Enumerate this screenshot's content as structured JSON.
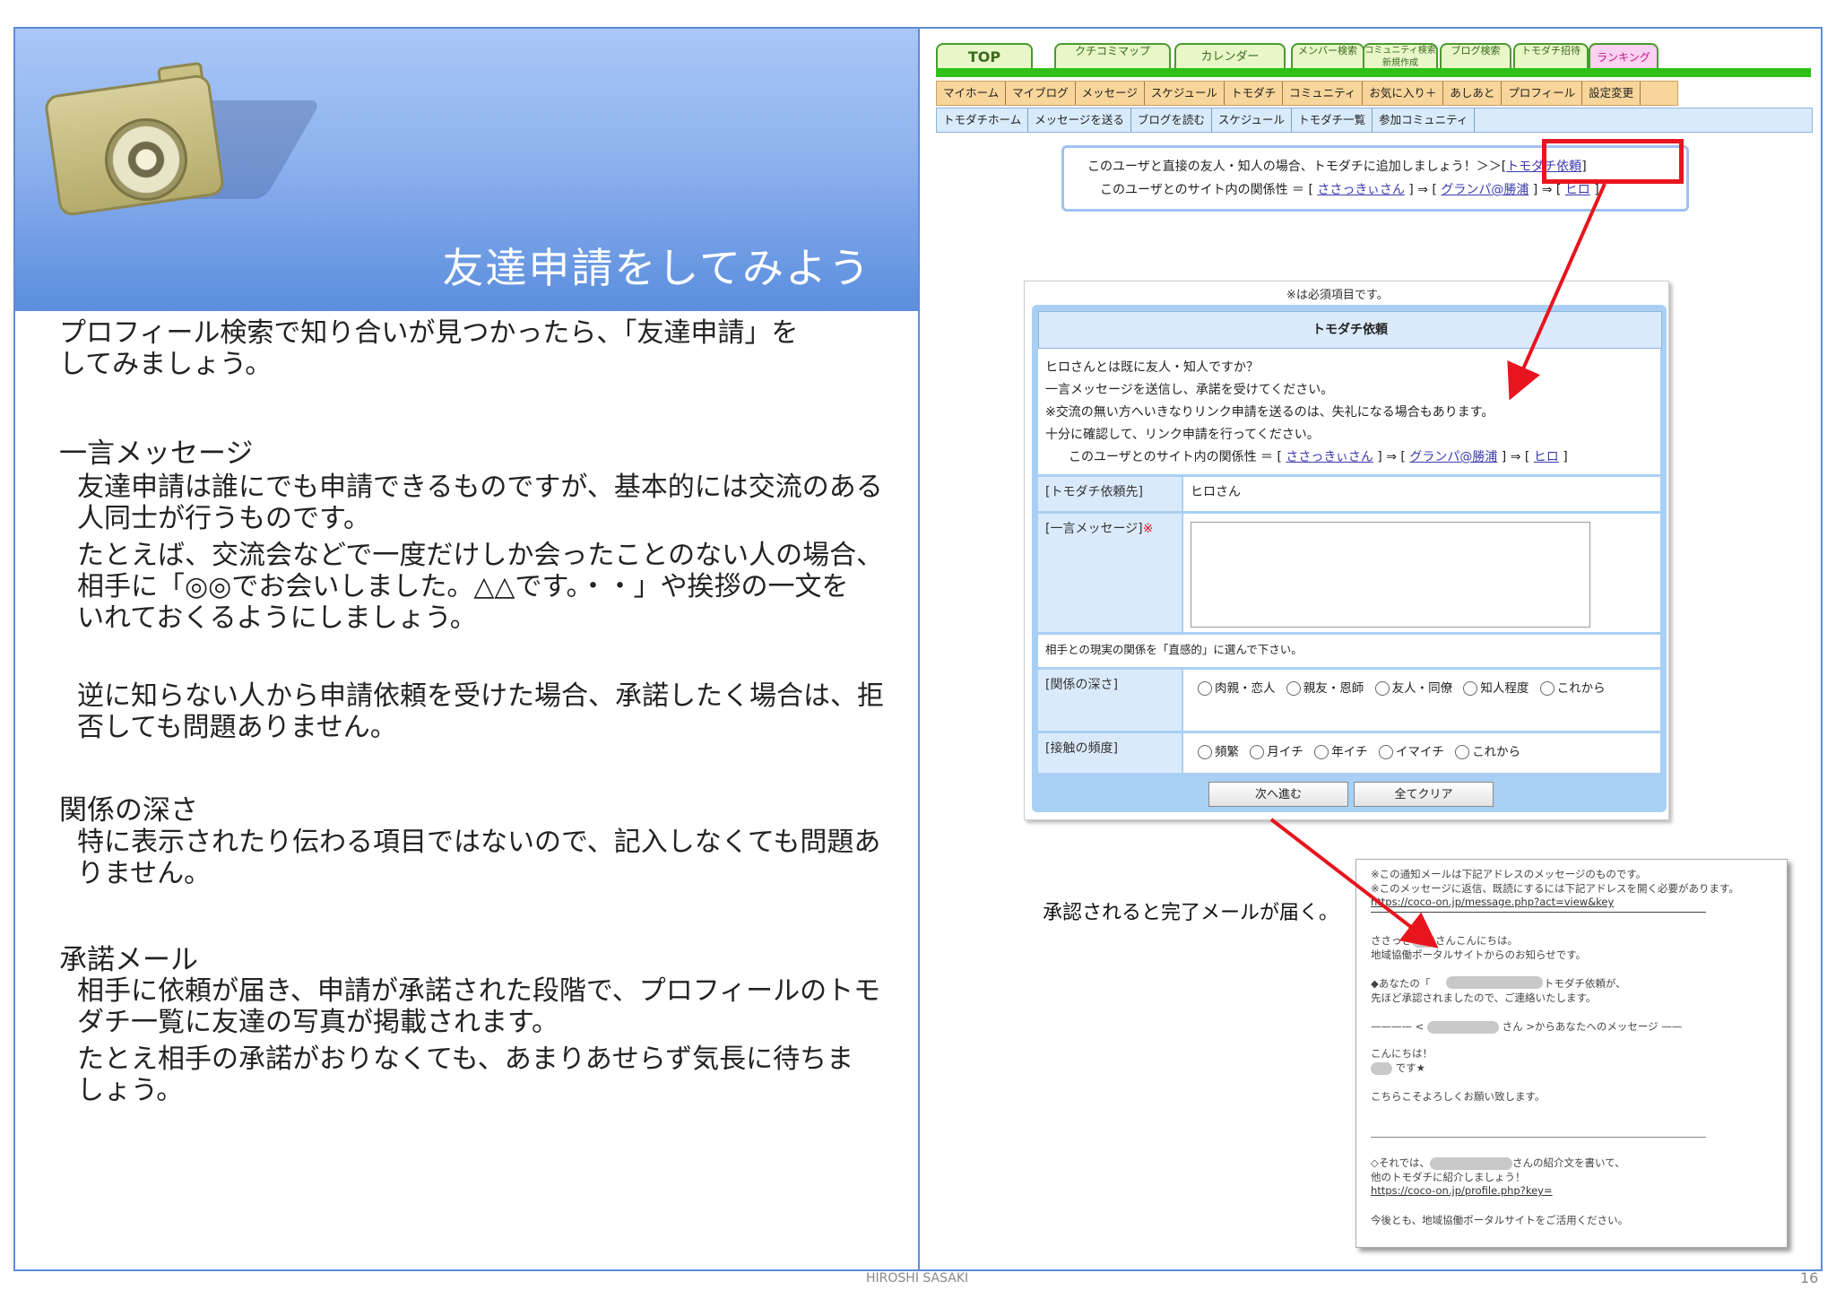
{
  "title": "友達申請をしてみよう",
  "left": {
    "intro": [
      "プロフィール検索で知り合いが見つかったら、「友達申請」を",
      "してみましょう。"
    ],
    "sections": [
      {
        "heading": "一言メッセージ",
        "lines": [
          "友達申請は誰にでも申請できるものですが、基本的には交流のある",
          "人同士が行うものです。",
          "たとえば、交流会などで一度だけしか会ったことのない人の場合、",
          "相手に「◎◎でお会いしました。△△です。・・」や挨拶の一文を",
          "いれておくるようにしましょう。",
          "逆に知らない人から申請依頼を受けた場合、承諾したく場合は、拒",
          "否しても問題ありません。"
        ]
      },
      {
        "heading": "関係の深さ",
        "lines": [
          "特に表示されたり伝わる項目ではないので、記入しなくても問題あ",
          "りません。"
        ]
      },
      {
        "heading": "承諾メール",
        "lines": [
          "相手に依頼が届き、申請が承諾された段階で、プロフィールのトモ",
          "ダチ一覧に友達の写真が掲載されます。",
          "たとえ相手の承諾がおりなくても、あまりあせらず気長に待ちま",
          "しょう。"
        ]
      }
    ]
  },
  "site": {
    "tabs": [
      "TOP",
      "クチコミマップ",
      "カレンダー",
      "メンバー検索",
      "コミュニティ検索 新規作成",
      "ブログ検索",
      "トモダチ招待",
      "ランキング"
    ],
    "menu1": [
      "マイホーム",
      "マイブログ",
      "メッセージ",
      "スケジュール",
      "トモダチ",
      "コミュニティ",
      "お気に入り＋",
      "あしあと",
      "プロフィール",
      "設定変更"
    ],
    "menu2": [
      "トモダチホーム",
      "メッセージを送る",
      "ブログを読む",
      "スケジュール",
      "トモダチ一覧",
      "参加コミュニティ"
    ],
    "notice_line1": "このユーザと直接の友人・知人の場合、トモダチに追加しましょう！＞＞",
    "notice_link": "トモダチ依頼",
    "notice_line2_prefix": "このユーザとのサイト内の関係性 ＝ [",
    "notice_rel": [
      "ささっきぃさん",
      "グランパ@勝浦",
      "ヒロ"
    ]
  },
  "form": {
    "required_note": "※は必須項目です。",
    "header": "トモダチ依頼",
    "intro": [
      "ヒロさんとは既に友人・知人ですか？",
      "一言メッセージを送信し、承諾を受けてください。",
      "※交流の無い方へいきなりリンク申請を送るのは、失礼になる場合もあります。",
      "十分に確認して、リンク申請を行ってください。"
    ],
    "relation_prefix": "このユーザとのサイト内の関係性 ＝ [",
    "relation": [
      "ささっきぃさん",
      "グランパ@勝浦",
      "ヒロ"
    ],
    "to_label": "[トモダチ依頼先]",
    "to_value": "ヒロさん",
    "msg_label": "[一言メッセージ]",
    "note": "相手との現実の関係を「直感的」に選んで下さい。",
    "depth_label": "[関係の深さ]",
    "depth_options": [
      "肉親・恋人",
      "親友・恩師",
      "友人・同僚",
      "知人程度",
      "これから"
    ],
    "freq_label": "[接触の頻度]",
    "freq_options": [
      "頻繁",
      "月イチ",
      "年イチ",
      "イマイチ",
      "これから"
    ],
    "next_btn": "次へ進む",
    "clear_btn": "全てクリア"
  },
  "caption": "承認されると完了メールが届く。",
  "mail": {
    "lines": [
      "※この通知メールは下記アドレスのメッセージのものです。",
      "※このメッセージに返信、既読にするには下記アドレスを開く必要があります。"
    ],
    "url1": "https://coco-on.jp/message.php?act=view&key",
    "greet": "さんこんにちは。",
    "from": "地域協働ポータルサイトからのお知らせです。",
    "notice": "◆あなたの「　　　　　　　　」へのトモダチ依頼が、",
    "notice2": "先ほど承認されましたので、ご連絡いたします。",
    "msgline": "さん >からあなたへのメッセージ ——",
    "hello": "こんにちは！",
    "desu": "です★",
    "regards": "こちらこそよろしくお願い致します。",
    "intro_line": "さんの紹介文を書いて、",
    "intro_line2": "他のトモダチに紹介しましょう！",
    "url2": "https://coco-on.jp/profile.php?key=",
    "closing": "今後とも、地域協働ポータルサイトをご活用ください。"
  },
  "footer": {
    "author": "HIROSHI SASAKI",
    "page": "16"
  }
}
